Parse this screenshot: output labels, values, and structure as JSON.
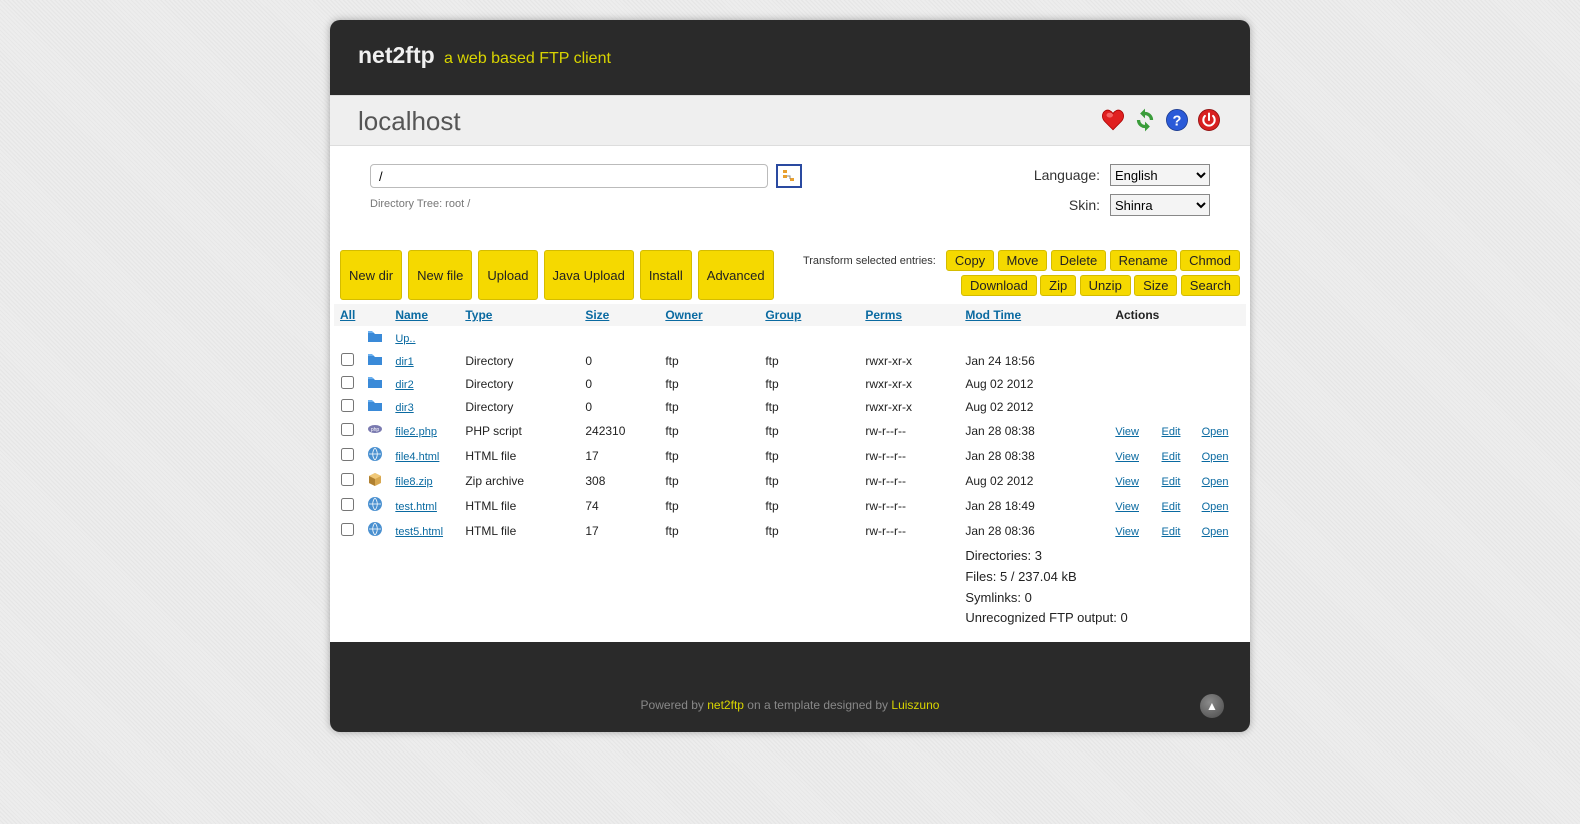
{
  "header": {
    "title": "net2ftp",
    "subtitle": "a web based FTP client"
  },
  "hostbar": {
    "hostname": "localhost"
  },
  "toolbar": {
    "directory_value": "/",
    "tree_label": "Directory Tree: root /",
    "language_label": "Language:",
    "language_value": "English",
    "skin_label": "Skin:",
    "skin_value": "Shinra"
  },
  "actions_left": [
    "New dir",
    "New file",
    "Upload",
    "Java Upload",
    "Install",
    "Advanced"
  ],
  "transform_label": "Transform selected entries:",
  "actions_right_row1": [
    "Copy",
    "Move",
    "Delete",
    "Rename",
    "Chmod"
  ],
  "actions_right_row2": [
    "Download",
    "Zip",
    "Unzip",
    "Size",
    "Search"
  ],
  "columns": {
    "all": "All",
    "name": "Name",
    "type": "Type",
    "size": "Size",
    "owner": "Owner",
    "group": "Group",
    "perms": "Perms",
    "modtime": "Mod Time",
    "actions": "Actions"
  },
  "up_label": "Up..",
  "rows": [
    {
      "icon": "folder",
      "name": "dir1",
      "type": "Directory",
      "size": "0",
      "owner": "ftp",
      "group": "ftp",
      "perms": "rwxr-xr-x",
      "mod": "Jan 24 18:56",
      "actions": false
    },
    {
      "icon": "folder",
      "name": "dir2",
      "type": "Directory",
      "size": "0",
      "owner": "ftp",
      "group": "ftp",
      "perms": "rwxr-xr-x",
      "mod": "Aug 02 2012",
      "actions": false
    },
    {
      "icon": "folder",
      "name": "dir3",
      "type": "Directory",
      "size": "0",
      "owner": "ftp",
      "group": "ftp",
      "perms": "rwxr-xr-x",
      "mod": "Aug 02 2012",
      "actions": false
    },
    {
      "icon": "php",
      "name": "file2.php",
      "type": "PHP script",
      "size": "242310",
      "owner": "ftp",
      "group": "ftp",
      "perms": "rw-r--r--",
      "mod": "Jan 28 08:38",
      "actions": true
    },
    {
      "icon": "html",
      "name": "file4.html",
      "type": "HTML file",
      "size": "17",
      "owner": "ftp",
      "group": "ftp",
      "perms": "rw-r--r--",
      "mod": "Jan 28 08:38",
      "actions": true
    },
    {
      "icon": "zip",
      "name": "file8.zip",
      "type": "Zip archive",
      "size": "308",
      "owner": "ftp",
      "group": "ftp",
      "perms": "rw-r--r--",
      "mod": "Aug 02 2012",
      "actions": true
    },
    {
      "icon": "html",
      "name": "test.html",
      "type": "HTML file",
      "size": "74",
      "owner": "ftp",
      "group": "ftp",
      "perms": "rw-r--r--",
      "mod": "Jan 28 18:49",
      "actions": true
    },
    {
      "icon": "html",
      "name": "test5.html",
      "type": "HTML file",
      "size": "17",
      "owner": "ftp",
      "group": "ftp",
      "perms": "rw-r--r--",
      "mod": "Jan 28 08:36",
      "actions": true
    }
  ],
  "row_actions": {
    "view": "View",
    "edit": "Edit",
    "open": "Open"
  },
  "summary": {
    "directories": "Directories: 3",
    "files": "Files: 5 / 237.04 kB",
    "symlinks": "Symlinks: 0",
    "unrecognized": "Unrecognized FTP output: 0"
  },
  "footer": {
    "prefix": "Powered by ",
    "link1": "net2ftp",
    "middle": " on a template designed by ",
    "link2": "Luiszuno"
  }
}
